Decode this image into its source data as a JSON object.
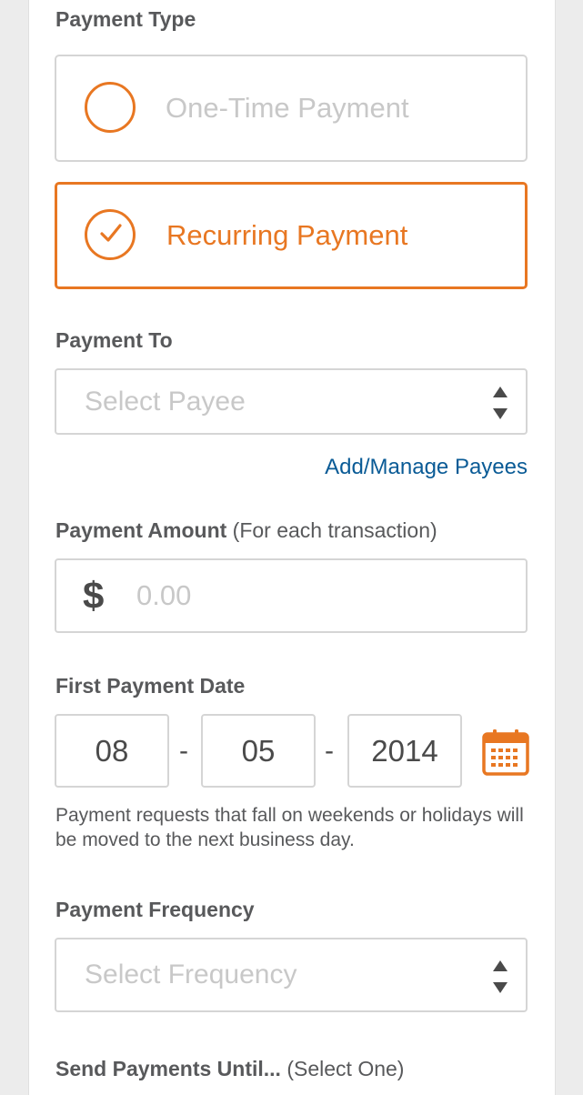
{
  "payment_type": {
    "label": "Payment Type",
    "options": [
      {
        "label": "One-Time Payment",
        "selected": false
      },
      {
        "label": "Recurring Payment",
        "selected": true
      }
    ]
  },
  "payment_to": {
    "label": "Payment To",
    "placeholder": "Select Payee",
    "manage_link": "Add/Manage Payees"
  },
  "payment_amount": {
    "label": "Payment Amount",
    "sublabel": "(For each transaction)",
    "currency_symbol": "$",
    "placeholder": "0.00"
  },
  "first_payment_date": {
    "label": "First Payment Date",
    "month": "08",
    "day": "05",
    "year": "2014",
    "separator": "-",
    "calendar_icon": "calendar-icon",
    "note": "Payment requests that fall on weekends or holidays will be moved to the next business day."
  },
  "payment_frequency": {
    "label": "Payment Frequency",
    "placeholder": "Select Frequency"
  },
  "send_until": {
    "label": "Send Payments Until...",
    "sublabel": "(Select One)"
  },
  "colors": {
    "accent": "#e87722",
    "link": "#0a5b96",
    "border": "#d5d5d5",
    "placeholder": "#c8c8c8",
    "label": "#58595b"
  }
}
